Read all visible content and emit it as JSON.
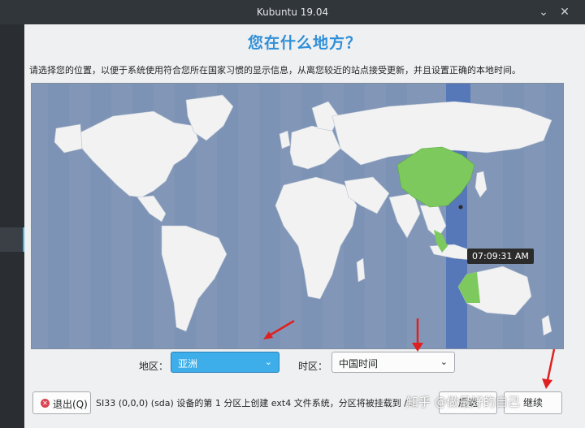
{
  "window": {
    "title": "Kubuntu 19.04",
    "minimize_glyph": "⌄",
    "close_glyph": "✕"
  },
  "page": {
    "heading": "您在什么地方？",
    "subtitle": "请选择您的位置，以便于系统使用符合您所在国家习惯的显示信息，从离您较近的站点接受更新，并且设置正确的本地时间。"
  },
  "map": {
    "time_label": "07:09:31 AM"
  },
  "region": {
    "label": "地区：",
    "value": "亚洲"
  },
  "zone": {
    "label": "时区：",
    "value": "中国时间"
  },
  "footer": {
    "quit_label": "退出(Q)",
    "status_text": "SI33 (0,0,0) (sda) 设备的第 1 分区上创建 ext4 文件系统，分区将被挂载到 /...",
    "back_label": "后退",
    "next_label": "继续"
  },
  "watermark": {
    "text": "知乎 @做最好的自己"
  },
  "colors": {
    "accent": "#3daee9",
    "heading": "#2f8fd8",
    "map_ocean": "#8297b8",
    "land": "#f2f2f2",
    "selected_country": "#7dc95e",
    "timezone_band": "#5677b8",
    "annotation_arrow": "#e02020"
  }
}
